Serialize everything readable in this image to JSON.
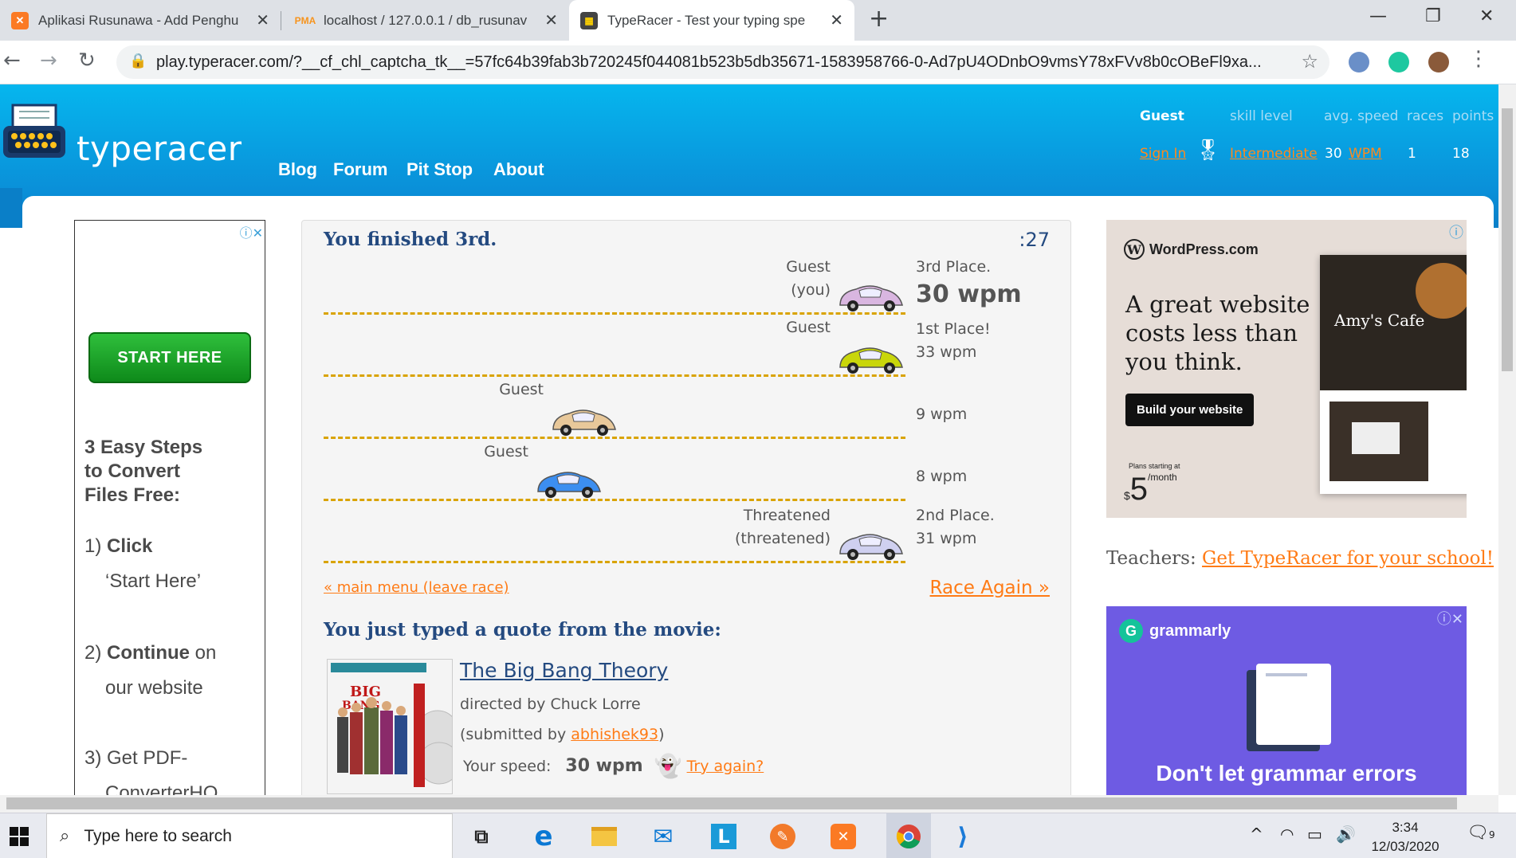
{
  "browser": {
    "tabs": [
      {
        "title": "Aplikasi Rusunawa - Add Penghu",
        "icon": "xampp-icon"
      },
      {
        "title": "localhost / 127.0.0.1 / db_rusunav",
        "icon": "phpmyadmin-icon"
      },
      {
        "title": "TypeRacer - Test your typing spe",
        "icon": "typeracer-icon"
      }
    ],
    "url": "play.typeracer.com/?__cf_chl_captcha_tk__=57fc64b39fab3b720245f044081b523b5db35671-1583958766-0-Ad7pU4ODnbO9vmsY78xFVv8b0cOBeFl9xa..."
  },
  "site": {
    "logo_text": "typeracer",
    "nav": [
      "Blog",
      "Forum",
      "Pit Stop",
      "About"
    ],
    "stats": {
      "user": "Guest",
      "headers": {
        "skill": "skill level",
        "speed": "avg. speed",
        "races": "races",
        "points": "points"
      },
      "sign_in": "Sign In",
      "skill": "Intermediate",
      "speed_value": "30",
      "speed_unit": "WPM",
      "races": "1",
      "points": "18"
    }
  },
  "race": {
    "result_title": "You finished 3rd.",
    "timer": ":27",
    "lanes": [
      {
        "name_line1": "Guest",
        "name_line2": "(you)",
        "color": "#d9b6e0",
        "progress": 1.0,
        "rank_line1": "3rd Place.",
        "rank_line2": "30 wpm",
        "big": true
      },
      {
        "name_line1": "Guest",
        "name_line2": "",
        "color": "#c9d60a",
        "progress": 1.0,
        "rank_line1": "1st Place!",
        "rank_line2": "33 wpm",
        "big": false
      },
      {
        "name_line1": "Guest",
        "name_line2": "",
        "color": "#e8c89a",
        "progress": 0.44,
        "rank_line1": "",
        "rank_line2": "9 wpm",
        "big": false
      },
      {
        "name_line1": "Guest",
        "name_line2": "",
        "color": "#3c8ef0",
        "progress": 0.41,
        "rank_line1": "",
        "rank_line2": "8 wpm",
        "big": false
      },
      {
        "name_line1": "Threatened",
        "name_line2": "(threatened)",
        "color": "#cfd0f0",
        "progress": 1.0,
        "rank_line1": "2nd Place.",
        "rank_line2": "31 wpm",
        "big": false
      }
    ],
    "main_menu": "« main menu (leave race)",
    "race_again": "Race Again »",
    "quote_heading": "You just typed a quote from the movie:",
    "movie_title": "The Big Bang Theory",
    "director": "directed by Chuck Lorre",
    "submitted_prefix": "(submitted by ",
    "submitted_user": "abhishek93",
    "submitted_suffix": ")",
    "your_speed_label": "Your speed:",
    "your_speed_value": "30 wpm",
    "try_again": "Try again?"
  },
  "ad_left": {
    "button": "START HERE",
    "headline": [
      "3 Easy Steps",
      "to Convert",
      "Files Free:"
    ],
    "step1a": "1) ",
    "step1b": "Click",
    "step1c": "‘Start Here’",
    "step2a": "2) ",
    "step2b": "Continue",
    "step2c": " on",
    "step2d": "our website",
    "step3a": "3) ",
    "step3b": "Get PDF-",
    "step3c": "ConverterHQ"
  },
  "ad_wordpress": {
    "brand": "WordPress.com",
    "headline": [
      "A great website",
      "costs less than",
      "you think."
    ],
    "cta": "Build your website",
    "plans": "Plans starting at",
    "price_symbol": "$",
    "price": "5",
    "per": "/month",
    "cafe": "Amy's Cafe"
  },
  "teachers": {
    "label": "Teachers",
    "link": "Get TypeRacer for your school!"
  },
  "ad_grammarly": {
    "brand": "grammarly",
    "headline": "Don't let grammar errors"
  },
  "taskbar": {
    "search_placeholder": "Type here to search",
    "time": "3:34",
    "date": "12/03/2020",
    "notifications": "9"
  }
}
